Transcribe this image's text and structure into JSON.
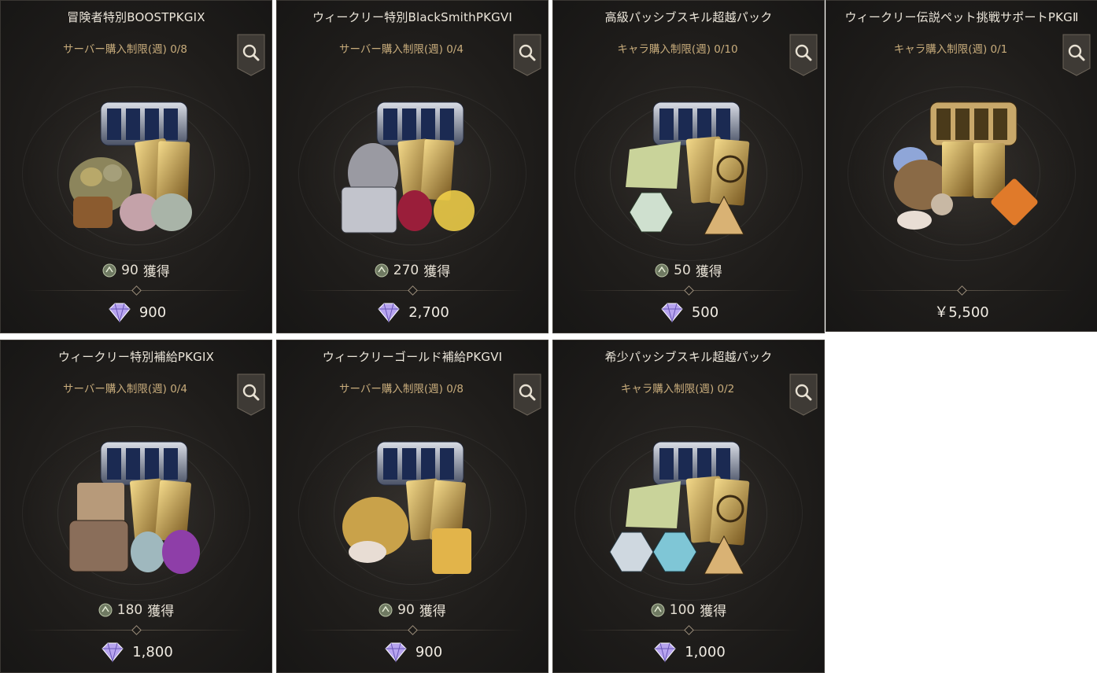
{
  "earn_suffix": "獲得",
  "cards": [
    {
      "title": "冒険者特別BOOSTPKGIX",
      "limit": "サーバー購入制限(週) 0/8",
      "earn": "90",
      "price": "900",
      "price_kind": "gem",
      "art": "boost"
    },
    {
      "title": "ウィークリー特別BlackSmithPKGVI",
      "limit": "サーバー購入制限(週) 0/4",
      "earn": "270",
      "price": "2,700",
      "price_kind": "gem",
      "art": "smith"
    },
    {
      "title": "高級パッシブスキル超越パック",
      "limit": "キャラ購入制限(週) 0/10",
      "earn": "50",
      "price": "500",
      "price_kind": "gem",
      "art": "passive"
    },
    {
      "title": "ウィークリー伝説ペット挑戦サポートPKGⅡ",
      "limit": "キャラ購入制限(週) 0/1",
      "earn": "",
      "price": "￥5,500",
      "price_kind": "yen",
      "art": "pet"
    },
    {
      "title": "ウィークリー特別補給PKGIX",
      "limit": "サーバー購入制限(週) 0/4",
      "earn": "180",
      "price": "1,800",
      "price_kind": "gem",
      "art": "supply"
    },
    {
      "title": "ウィークリーゴールド補給PKGVI",
      "limit": "サーバー購入制限(週) 0/8",
      "earn": "90",
      "price": "900",
      "price_kind": "gem",
      "art": "gold"
    },
    {
      "title": "希少パッシブスキル超越パック",
      "limit": "キャラ購入制限(週) 0/2",
      "earn": "100",
      "price": "1,000",
      "price_kind": "gem",
      "art": "passive2"
    }
  ]
}
